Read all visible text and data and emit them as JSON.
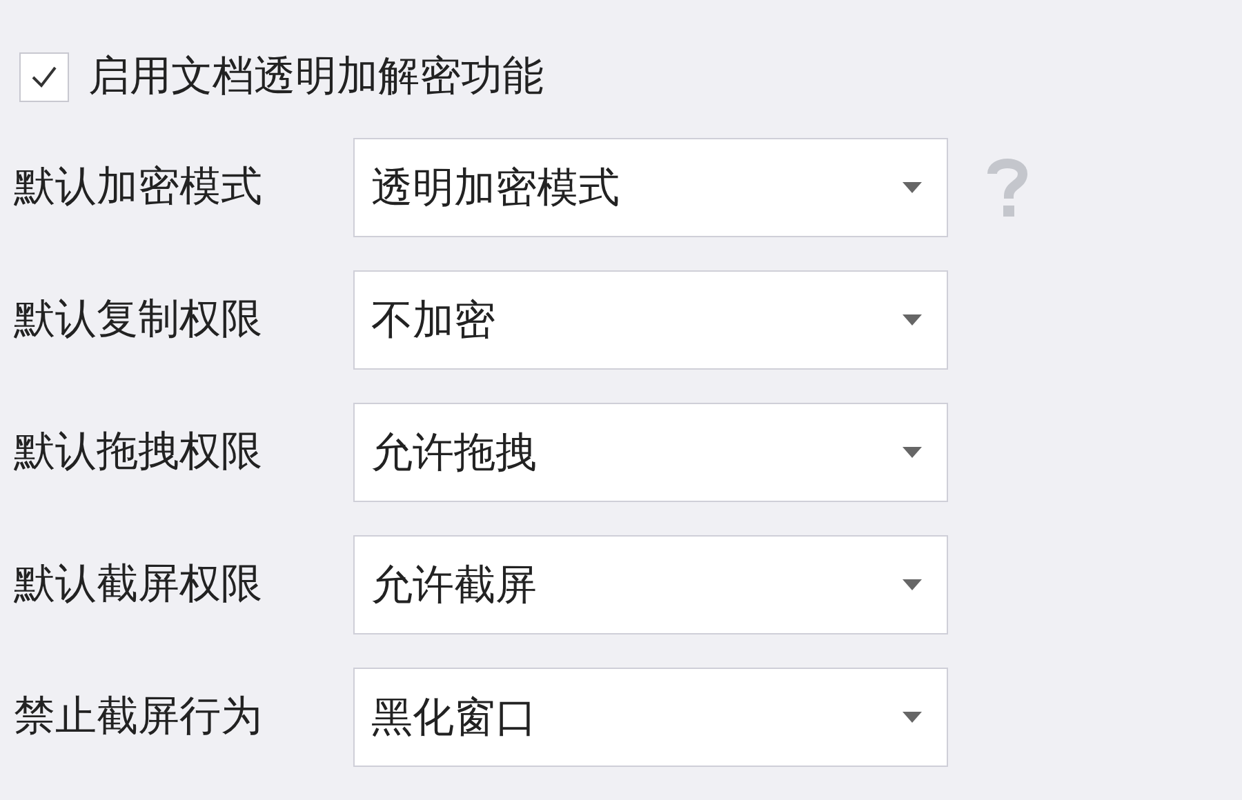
{
  "enable_checkbox": {
    "label": "启用文档透明加解密功能",
    "checked": true
  },
  "settings": [
    {
      "kind": "help",
      "label": "默认加密模式",
      "value": "透明加密模式"
    },
    {
      "kind": "plain",
      "label": "默认复制权限",
      "value": "不加密"
    },
    {
      "kind": "plain",
      "label": "默认拖拽权限",
      "value": "允许拖拽"
    },
    {
      "kind": "plain",
      "label": "默认截屏权限",
      "value": "允许截屏"
    },
    {
      "kind": "plain",
      "label": "禁止截屏行为",
      "value": "黑化窗口"
    }
  ]
}
